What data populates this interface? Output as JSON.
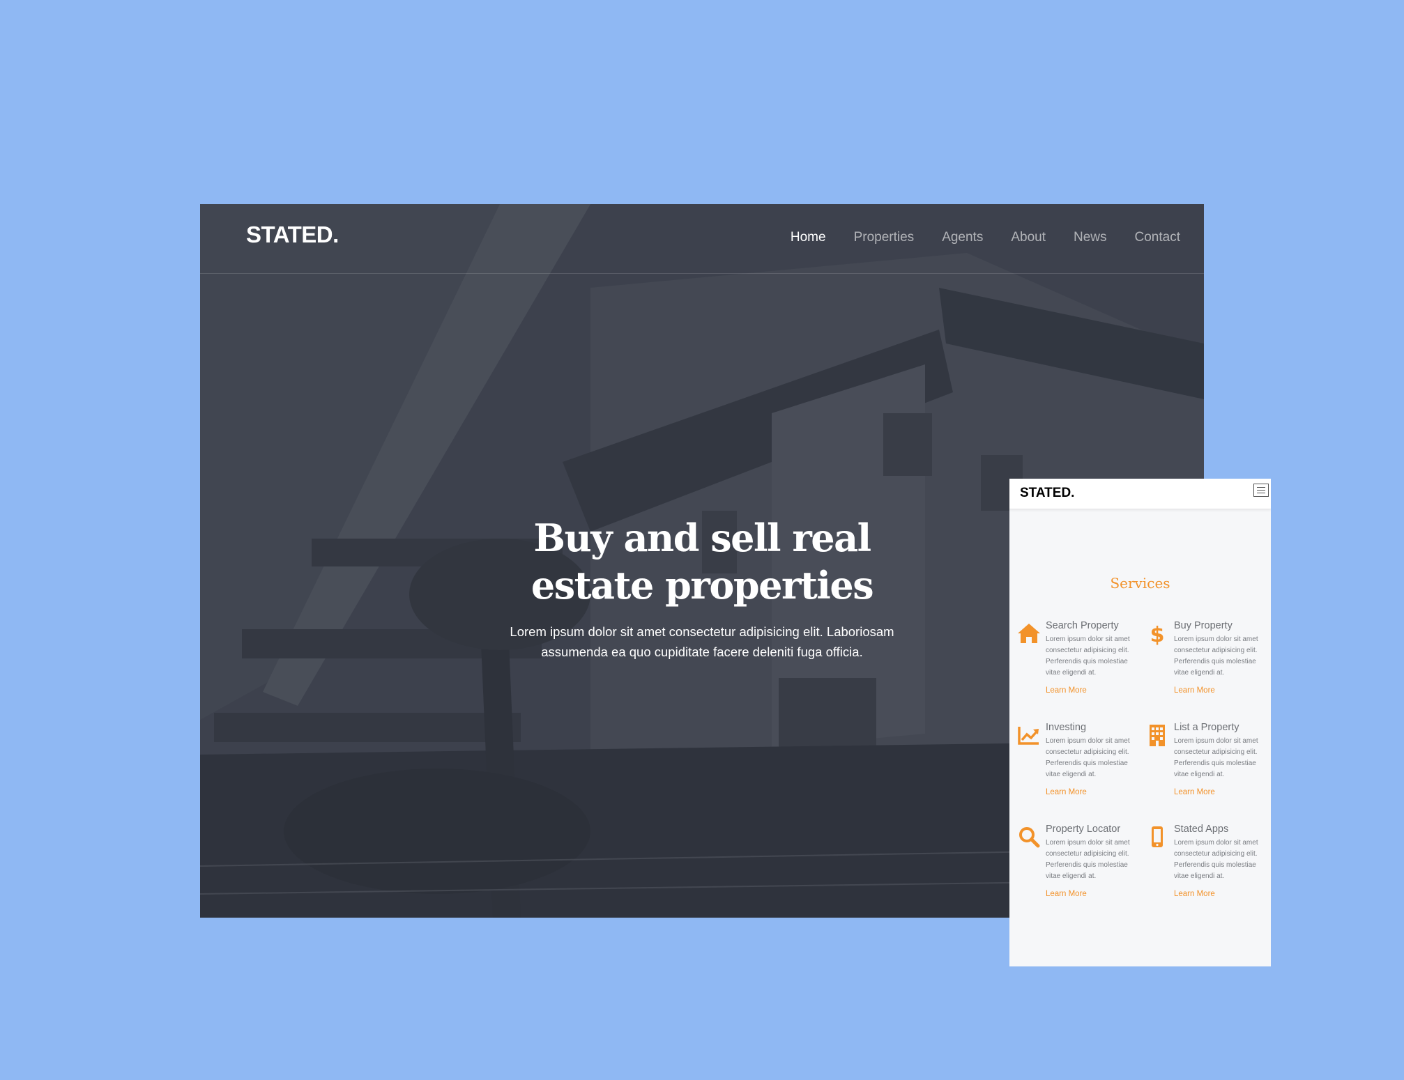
{
  "desktop": {
    "brand": "STATED.",
    "nav": [
      "Home",
      "Properties",
      "Agents",
      "About",
      "News",
      "Contact"
    ],
    "hero": {
      "title": "Buy and sell real estate properties",
      "subtitle": "Lorem ipsum dolor sit amet consectetur adipisicing elit. Laboriosam assumenda ea quo cupiditate facere deleniti fuga officia."
    }
  },
  "mobile": {
    "brand": "STATED.",
    "section_title": "Services",
    "services": [
      {
        "icon": "home-icon",
        "name": "Search Property",
        "desc": "Lorem ipsum dolor sit amet consectetur adipisicing elit. Perferendis quis molestiae vitae eligendi at.",
        "link": "Learn More"
      },
      {
        "icon": "dollar-icon",
        "name": "Buy Property",
        "desc": "Lorem ipsum dolor sit amet consectetur adipisicing elit. Perferendis quis molestiae vitae eligendi at.",
        "link": "Learn More"
      },
      {
        "icon": "chart-line-icon",
        "name": "Investing",
        "desc": "Lorem ipsum dolor sit amet consectetur adipisicing elit. Perferendis quis molestiae vitae eligendi at.",
        "link": "Learn More"
      },
      {
        "icon": "building-icon",
        "name": "List a Property",
        "desc": "Lorem ipsum dolor sit amet consectetur adipisicing elit. Perferendis quis molestiae vitae eligendi at.",
        "link": "Learn More"
      },
      {
        "icon": "search-icon",
        "name": "Property Locator",
        "desc": "Lorem ipsum dolor sit amet consectetur adipisicing elit. Perferendis quis molestiae vitae eligendi at.",
        "link": "Learn More"
      },
      {
        "icon": "mobile-phone-icon",
        "name": "Stated Apps",
        "desc": "Lorem ipsum dolor sit amet consectetur adipisicing elit. Perferendis quis molestiae vitae eligendi at.",
        "link": "Learn More"
      }
    ]
  },
  "colors": {
    "background": "#8fb8f3",
    "accent": "#f2922a",
    "hero_overlay": "#2d323c"
  }
}
